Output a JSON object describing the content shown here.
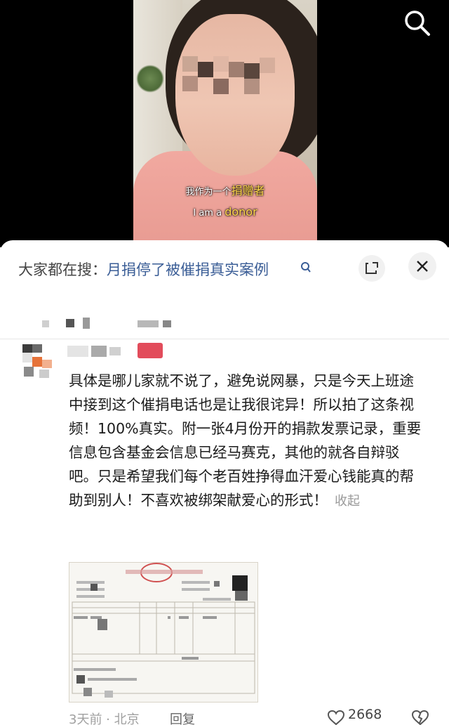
{
  "video": {
    "caption_zh_prefix": "我作为一个",
    "caption_zh_highlight": "捐赠者",
    "caption_en_prefix": "I am a ",
    "caption_en_highlight": "donor"
  },
  "search_bar": {
    "label": "大家都在搜：",
    "query": "月捐停了被催捐真实案例"
  },
  "comment": {
    "text": "具体是哪儿家就不说了，避免说网暴，只是今天上班途中接到这个催捐电话也是让我很诧异！所以拍了这条视频！100%真实。附一张4月份开的捐款发票记录，重要信息包含基金会信息已经马赛克，其他的就各自辩驳吧。只是希望我们每个老百姓挣得血汗爱心钱能真的帮助到别人！不喜欢被绑架献爱心的形式！",
    "collapse_label": "收起",
    "time_location": "3天前 · 北京",
    "reply_label": "回复",
    "likes": "2668"
  },
  "colors": {
    "query_link": "#3a5d96",
    "caption_highlight": "#ffd84a"
  }
}
